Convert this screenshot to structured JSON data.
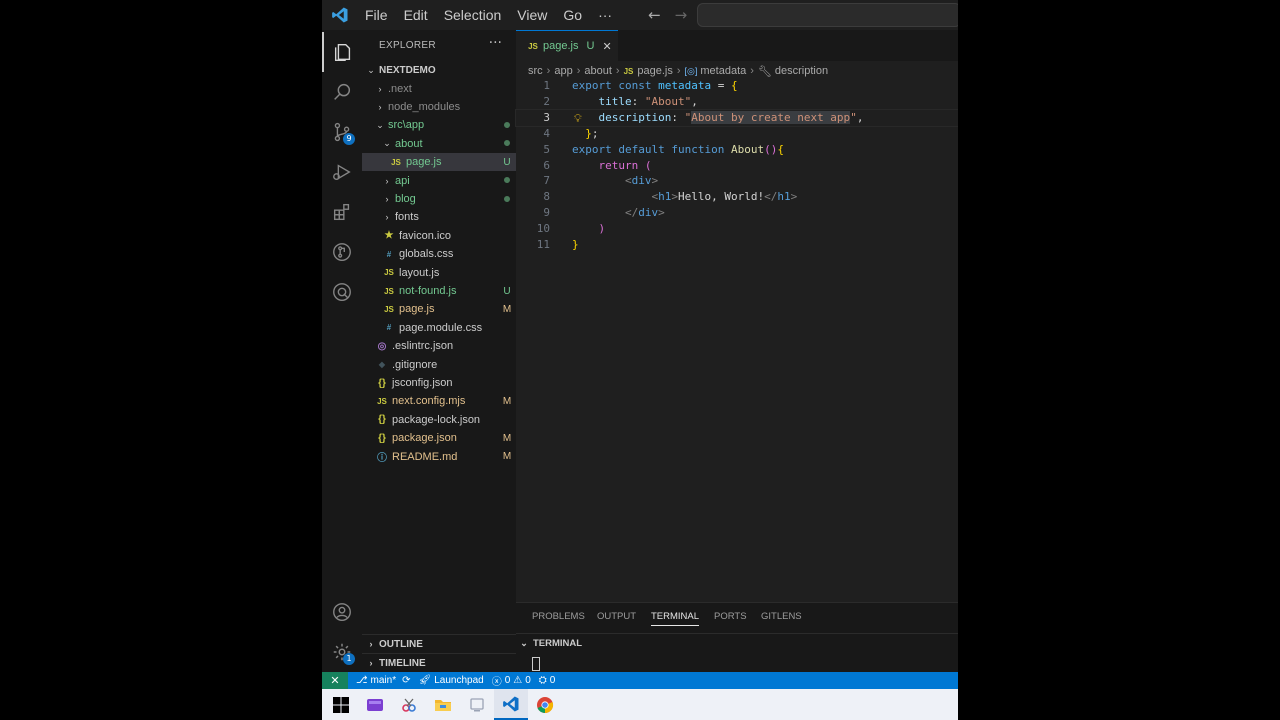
{
  "titlebar": {
    "menu": [
      "File",
      "Edit",
      "Selection",
      "View",
      "Go",
      "···"
    ],
    "back_icon": "arrow-left-icon",
    "forward_icon": "arrow-right-icon"
  },
  "activity_bar": {
    "items": [
      "explorer-icon",
      "search-icon",
      "source-control-icon",
      "run-debug-icon",
      "extensions-icon",
      "gitlens-icon",
      "remote-icon"
    ],
    "source_control_badge": "9",
    "manage_badge": "1"
  },
  "explorer": {
    "title": "EXPLORER",
    "more": "···",
    "root": "NEXTDEMO",
    "items": [
      {
        "label": ".next",
        "chev": "›",
        "icon": "",
        "status": "",
        "color": "#8c8c8c"
      },
      {
        "label": "node_modules",
        "chev": "›",
        "icon": "",
        "status": "",
        "color": "#8c8c8c"
      },
      {
        "label": "src\\app",
        "chev": "⌄",
        "icon": "",
        "status": "dot",
        "color": "#73c991"
      },
      {
        "label": "about",
        "chev": "⌄",
        "icon": "",
        "status": "dot",
        "color": "#73c991"
      },
      {
        "label": "page.js",
        "chev": "",
        "icon": "JS",
        "status": "U",
        "color": "#73c991"
      },
      {
        "label": "api",
        "chev": "›",
        "icon": "",
        "status": "dot",
        "color": "#73c991"
      },
      {
        "label": "blog",
        "chev": "›",
        "icon": "",
        "status": "dot",
        "color": "#73c991"
      },
      {
        "label": "fonts",
        "chev": "›",
        "icon": "",
        "status": "",
        "color": "#cccccc"
      },
      {
        "label": "favicon.ico",
        "chev": "",
        "icon": "★",
        "status": "",
        "color": "#cccccc"
      },
      {
        "label": "globals.css",
        "chev": "",
        "icon": "#",
        "status": "",
        "color": "#cccccc"
      },
      {
        "label": "layout.js",
        "chev": "",
        "icon": "JS",
        "status": "",
        "color": "#cccccc"
      },
      {
        "label": "not-found.js",
        "chev": "",
        "icon": "JS",
        "status": "U",
        "color": "#73c991"
      },
      {
        "label": "page.js",
        "chev": "",
        "icon": "JS",
        "status": "M",
        "color": "#e2c08d"
      },
      {
        "label": "page.module.css",
        "chev": "",
        "icon": "#",
        "status": "",
        "color": "#cccccc"
      },
      {
        "label": ".eslintrc.json",
        "chev": "",
        "icon": "◎",
        "status": "",
        "color": "#cccccc"
      },
      {
        "label": ".gitignore",
        "chev": "",
        "icon": "◆",
        "status": "",
        "color": "#cccccc"
      },
      {
        "label": "jsconfig.json",
        "chev": "",
        "icon": "{}",
        "status": "",
        "color": "#cccccc"
      },
      {
        "label": "next.config.mjs",
        "chev": "",
        "icon": "JS",
        "status": "M",
        "color": "#e2c08d"
      },
      {
        "label": "package-lock.json",
        "chev": "",
        "icon": "{}",
        "status": "",
        "color": "#cccccc"
      },
      {
        "label": "package.json",
        "chev": "",
        "icon": "{}",
        "status": "M",
        "color": "#e2c08d"
      },
      {
        "label": "README.md",
        "chev": "",
        "icon": "ⓘ",
        "status": "M",
        "color": "#e2c08d"
      }
    ],
    "outline": "OUTLINE",
    "timeline": "TIMELINE"
  },
  "editor": {
    "tab": {
      "icon": "JS",
      "name": "page.js",
      "status": "U",
      "close": "✕"
    },
    "breadcrumb": [
      "src",
      "app",
      "about",
      "page.js",
      "metadata",
      "description"
    ],
    "lines": [
      "export const metadata = {",
      "    title: \"About\",",
      "    description: \"About by create next app\",",
      "  };",
      "export default function About(){",
      "    return (",
      "        <div>",
      "            <h1>Hello, World!</h1>",
      "        </div>",
      "    )",
      "}"
    ],
    "line_numbers": [
      "1",
      "2",
      "3",
      "4",
      "5",
      "6",
      "7",
      "8",
      "9",
      "10",
      "11"
    ],
    "current_line": 3
  },
  "panel": {
    "tabs": [
      "PROBLEMS",
      "OUTPUT",
      "TERMINAL",
      "PORTS",
      "GITLENS"
    ],
    "active_tab": "TERMINAL",
    "terminal_header": "TERMINAL"
  },
  "statusbar": {
    "remote": "✕",
    "branch": "main*",
    "launchpad": "Launchpad",
    "errors": "0",
    "warnings": "0",
    "ports": "0"
  },
  "taskbar": {
    "icons": [
      "windows-start-icon",
      "app-purple-icon",
      "snipping-tool-icon",
      "file-explorer-icon",
      "app-generic-icon",
      "vscode-icon",
      "chrome-icon"
    ],
    "active": "vscode-icon"
  },
  "colors": {
    "accent": "#0078d4",
    "remote": "#16825d",
    "untracked": "#73c991",
    "modified": "#e2c08d"
  }
}
